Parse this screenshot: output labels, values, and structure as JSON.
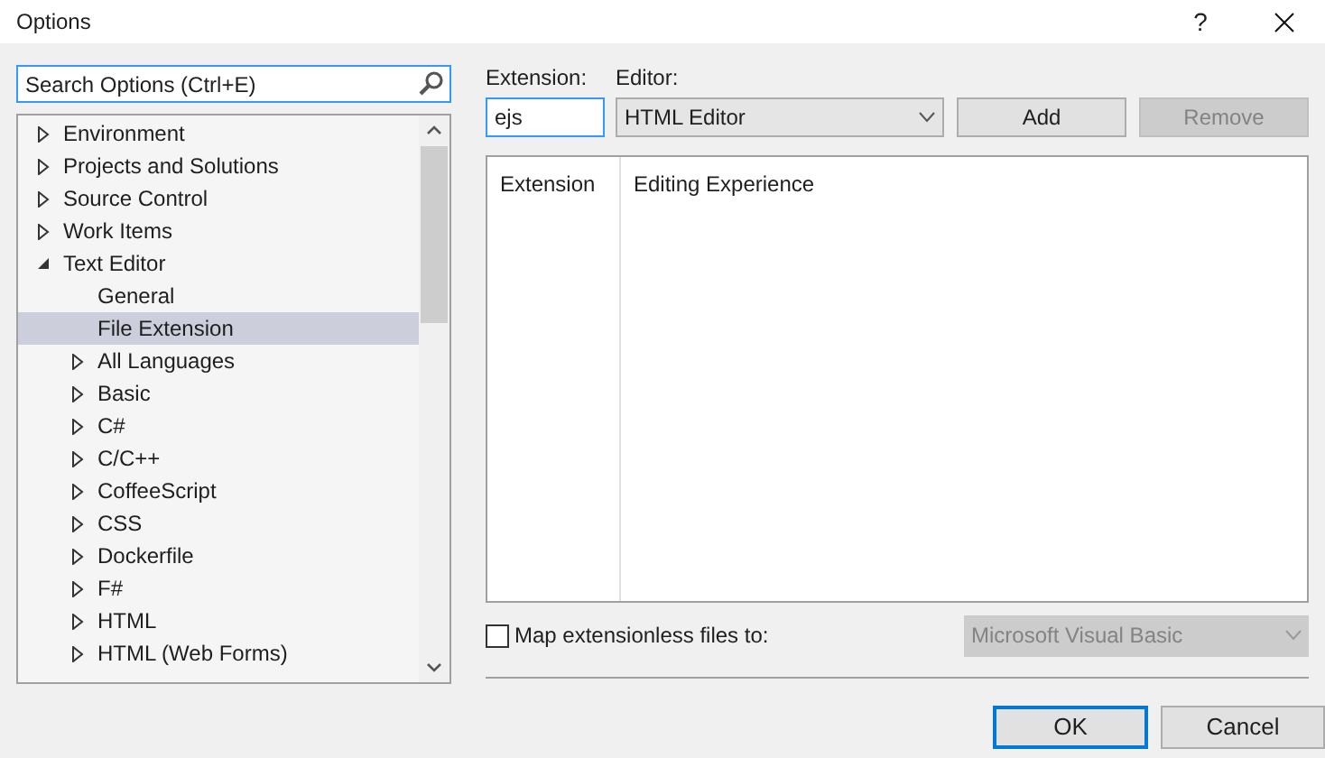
{
  "window": {
    "title": "Options",
    "help": "?"
  },
  "search": {
    "placeholder": "Search Options (Ctrl+E)"
  },
  "tree": [
    {
      "label": "Environment",
      "expandable": true,
      "expanded": false,
      "selected": false
    },
    {
      "label": "Projects and Solutions",
      "expandable": true,
      "expanded": false,
      "selected": false
    },
    {
      "label": "Source Control",
      "expandable": true,
      "expanded": false,
      "selected": false
    },
    {
      "label": "Work Items",
      "expandable": true,
      "expanded": false,
      "selected": false
    },
    {
      "label": "Text Editor",
      "expandable": true,
      "expanded": true,
      "selected": false,
      "children": [
        {
          "label": "General",
          "expandable": false,
          "expanded": false,
          "selected": false
        },
        {
          "label": "File Extension",
          "expandable": false,
          "expanded": false,
          "selected": true
        },
        {
          "label": "All Languages",
          "expandable": true,
          "expanded": false,
          "selected": false
        },
        {
          "label": "Basic",
          "expandable": true,
          "expanded": false,
          "selected": false
        },
        {
          "label": "C#",
          "expandable": true,
          "expanded": false,
          "selected": false
        },
        {
          "label": "C/C++",
          "expandable": true,
          "expanded": false,
          "selected": false
        },
        {
          "label": "CoffeeScript",
          "expandable": true,
          "expanded": false,
          "selected": false
        },
        {
          "label": "CSS",
          "expandable": true,
          "expanded": false,
          "selected": false
        },
        {
          "label": "Dockerfile",
          "expandable": true,
          "expanded": false,
          "selected": false
        },
        {
          "label": "F#",
          "expandable": true,
          "expanded": false,
          "selected": false
        },
        {
          "label": "HTML",
          "expandable": true,
          "expanded": false,
          "selected": false
        },
        {
          "label": "HTML (Web Forms)",
          "expandable": true,
          "expanded": false,
          "selected": false
        }
      ]
    }
  ],
  "extension": {
    "label": "Extension:",
    "value": "ejs"
  },
  "editor": {
    "label": "Editor:",
    "value": "HTML Editor"
  },
  "buttons": [
    {
      "label": "Add",
      "disabled": false
    },
    {
      "label": "Remove",
      "disabled": true
    }
  ],
  "table": {
    "columns": [
      "Extension",
      "Editing Experience"
    ]
  },
  "map_extensionless": {
    "label": "Map extensionless files to:",
    "checked": false,
    "value": "Microsoft Visual Basic",
    "disabled": true
  },
  "footer_buttons": [
    {
      "label": "OK",
      "default": true
    },
    {
      "label": "Cancel",
      "default": false
    }
  ]
}
